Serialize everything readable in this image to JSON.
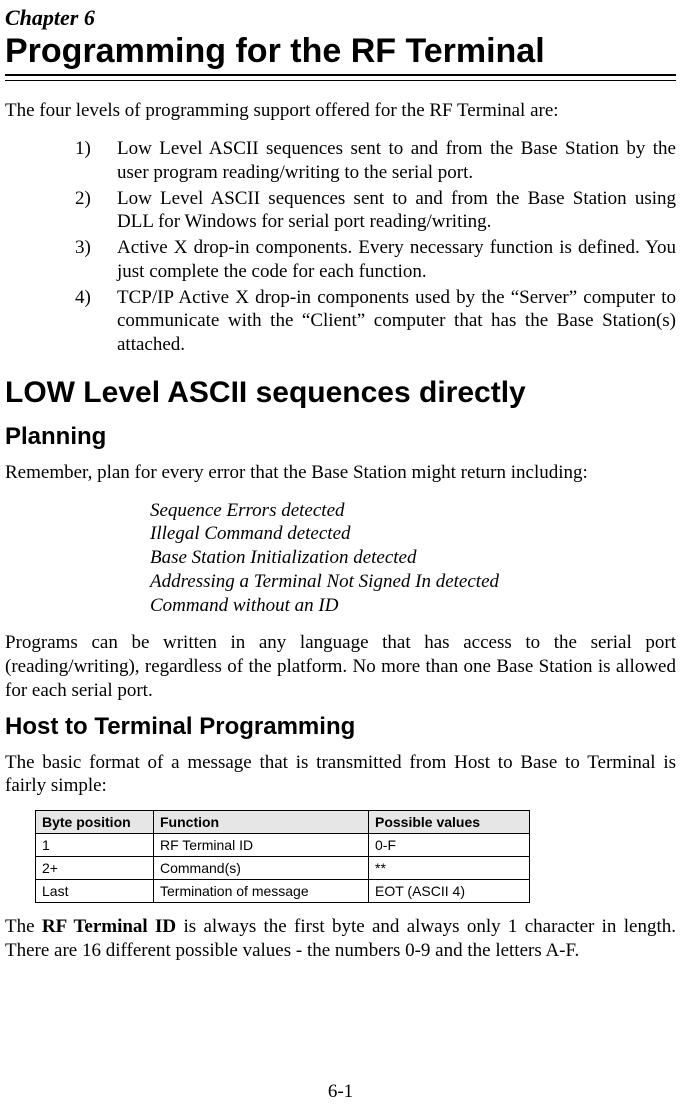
{
  "chapter_label": "Chapter 6",
  "chapter_title": "Programming for the RF Terminal",
  "intro": "The four levels of programming support offered for the RF Terminal are:",
  "list_items": [
    {
      "marker": "1)",
      "text": "Low Level ASCII sequences sent to and from the Base Station by the user program reading/writing to the serial port."
    },
    {
      "marker": "2)",
      "text": "Low Level ASCII sequences sent to and from the Base Station using DLL for Windows for serial port reading/writing."
    },
    {
      "marker": "3)",
      "text": "Active X drop-in components. Every necessary function is defined. You just complete the code for each function."
    },
    {
      "marker": "4)",
      "text": "TCP/IP Active X drop-in components used by the “Server” computer to communicate with the “Client” computer that has the Base Station(s) attached."
    }
  ],
  "section_heading": "LOW Level ASCII sequences directly",
  "sub_heading_1": "Planning",
  "planning_intro": "Remember, plan for every error that the Base Station might return including:",
  "errors": [
    "Sequence Errors detected",
    "Illegal Command detected",
    "Base Station Initialization detected",
    "Addressing a Terminal Not Signed In detected",
    "Command without an ID"
  ],
  "programs_para": "Programs can be written in any language that has access to the serial port (reading/writing), regardless of the platform. No more than one Base Station is allowed for each serial port.",
  "sub_heading_2": "Host to Terminal Programming",
  "host_intro": "The basic format of a message that is transmitted from Host to Base to Terminal is fairly simple:",
  "table": {
    "headers": [
      "Byte position",
      "Function",
      "Possible values"
    ],
    "rows": [
      [
        "1",
        "RF Terminal ID",
        "0-F"
      ],
      [
        "2+",
        "Command(s)",
        "**"
      ],
      [
        "Last",
        "Termination of message",
        "EOT (ASCII 4)"
      ]
    ]
  },
  "closing_para_before": "The ",
  "closing_bold": "RF Terminal ID",
  "closing_para_after": " is always the first byte and always only 1 character in length.  There are 16 different possible values - the numbers 0-9 and the letters A-F.",
  "page_number": "6-1"
}
